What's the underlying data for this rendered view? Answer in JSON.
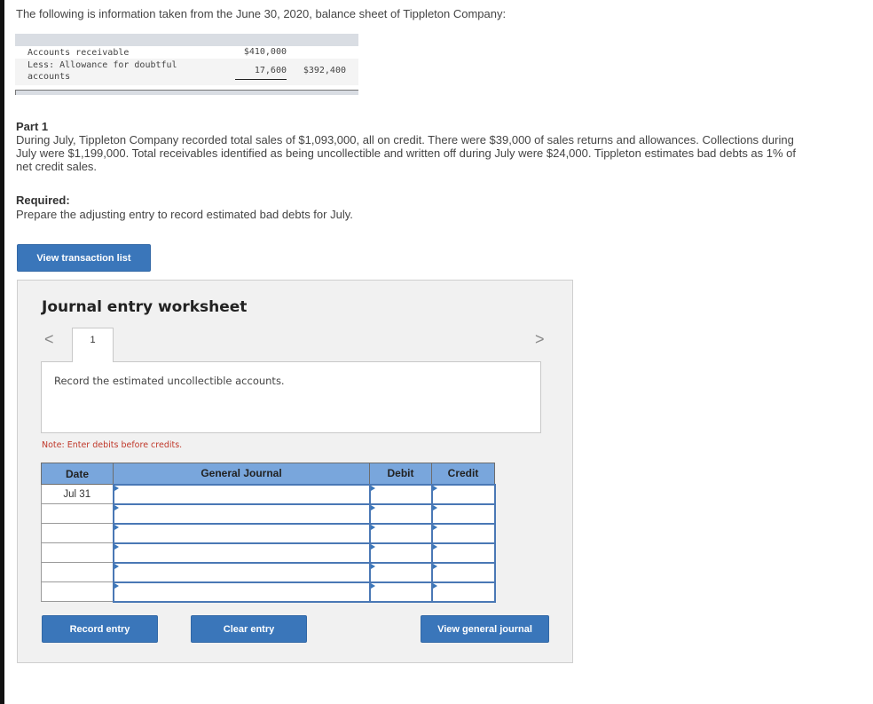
{
  "intro": "The following is information taken from the June 30, 2020, balance sheet of Tippleton Company:",
  "balance_sheet": {
    "rows": [
      {
        "label": "Accounts receivable",
        "amount1": "$410,000",
        "amount2": ""
      },
      {
        "label": "Less: Allowance for doubtful accounts",
        "amount1": "17,600",
        "amount2": "$392,400"
      }
    ]
  },
  "part1": {
    "title": "Part 1",
    "body": "During July, Tippleton Company recorded total sales of $1,093,000, all on credit. There were $39,000 of sales returns and allowances. Collections during July were $1,199,000. Total receivables identified as being uncollectible and written off during July were $24,000. Tippleton estimates bad debts as 1% of net credit sales."
  },
  "required": {
    "title": "Required:",
    "body": "Prepare the adjusting entry to record estimated bad debts for July."
  },
  "buttons": {
    "view_transaction_list": "View transaction list",
    "record_entry": "Record entry",
    "clear_entry": "Clear entry",
    "view_general_journal": "View general journal"
  },
  "worksheet": {
    "title": "Journal entry worksheet",
    "nav_prev": "<",
    "nav_next": ">",
    "tabs": [
      {
        "label": "1"
      }
    ],
    "description": "Record the estimated uncollectible accounts.",
    "note": "Note: Enter debits before credits.",
    "table": {
      "headers": [
        "Date",
        "General Journal",
        "Debit",
        "Credit"
      ],
      "rows": [
        {
          "date": "Jul 31",
          "account": "",
          "debit": "",
          "credit": ""
        },
        {
          "date": "",
          "account": "",
          "debit": "",
          "credit": ""
        },
        {
          "date": "",
          "account": "",
          "debit": "",
          "credit": ""
        },
        {
          "date": "",
          "account": "",
          "debit": "",
          "credit": ""
        },
        {
          "date": "",
          "account": "",
          "debit": "",
          "credit": ""
        },
        {
          "date": "",
          "account": "",
          "debit": "",
          "credit": ""
        }
      ]
    }
  },
  "colors": {
    "button_blue": "#3a76ba",
    "header_blue": "#79a6dc",
    "note_red": "#c0392b",
    "panel_bg": "#f1f1f1"
  }
}
